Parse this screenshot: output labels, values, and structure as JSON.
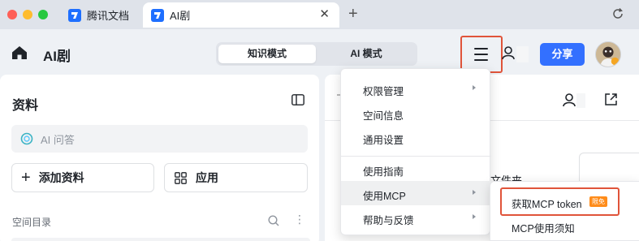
{
  "browser": {
    "tabs": [
      {
        "label": "腾讯文档"
      },
      {
        "label": "AI剧"
      }
    ]
  },
  "header": {
    "title": "AI剧",
    "modes": [
      {
        "label": "知识模式",
        "selected": true
      },
      {
        "label": "AI 模式",
        "selected": false
      }
    ],
    "share_label": "分享"
  },
  "left_panel": {
    "title": "资料",
    "ai_ask_placeholder": "AI 问答",
    "add_label": "添加资料",
    "apps_label": "应用",
    "directory_label": "空间目录"
  },
  "right_panel": {
    "folder_fragment": "文件夹"
  },
  "menu": {
    "items": [
      {
        "label": "权限管理",
        "has_submenu": true
      },
      {
        "label": "空间信息",
        "has_submenu": false
      },
      {
        "label": "通用设置",
        "has_submenu": false
      },
      {
        "label": "使用指南",
        "has_submenu": false
      },
      {
        "label": "使用MCP",
        "has_submenu": true
      },
      {
        "label": "帮助与反馈",
        "has_submenu": true
      }
    ]
  },
  "submenu": {
    "items": [
      {
        "label": "获取MCP token",
        "badge": "限免"
      },
      {
        "label": "MCP使用须知"
      }
    ]
  },
  "colors": {
    "accent": "#3370ff",
    "highlight_border": "#e0543a",
    "badge": "#ff8c1a"
  }
}
